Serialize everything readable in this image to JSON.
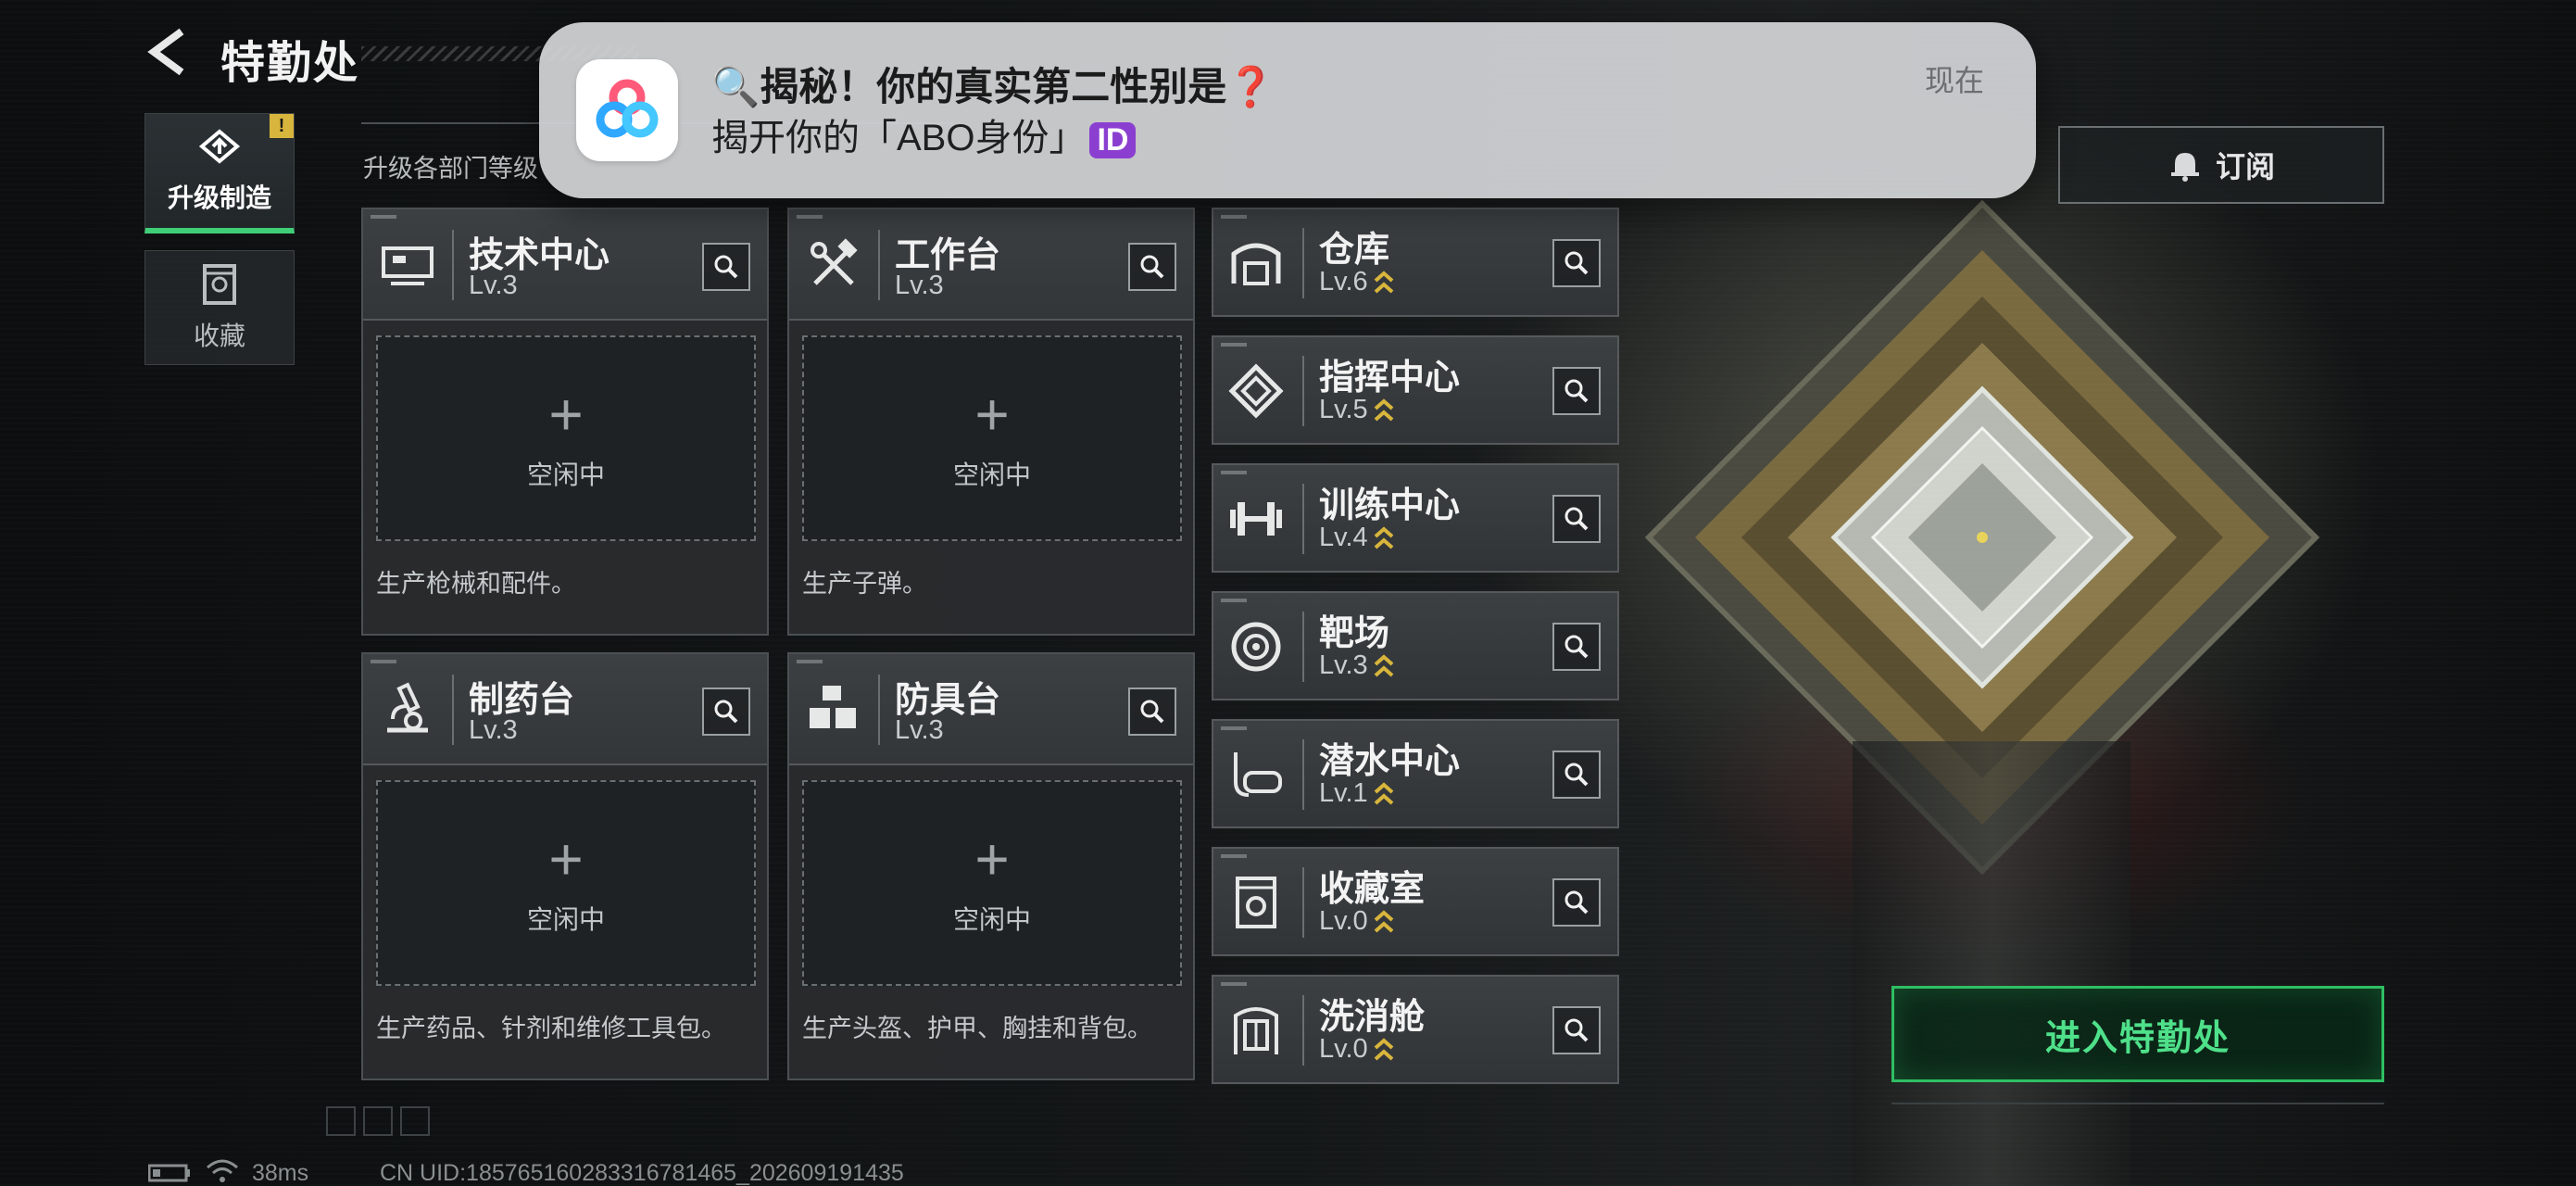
{
  "header": {
    "title": "特勤处"
  },
  "nav": {
    "items": [
      {
        "label": "升级制造",
        "badge": "!"
      },
      {
        "label": "收藏"
      }
    ]
  },
  "subtitle": "升级各部门等级",
  "stations": [
    {
      "name": "技术中心",
      "level": "Lv.3",
      "slot": "空闲中",
      "desc": "生产枪械和配件。"
    },
    {
      "name": "工作台",
      "level": "Lv.3",
      "slot": "空闲中",
      "desc": "生产子弹。"
    },
    {
      "name": "制药台",
      "level": "Lv.3",
      "slot": "空闲中",
      "desc": "生产药品、针剂和维修工具包。"
    },
    {
      "name": "防具台",
      "level": "Lv.3",
      "slot": "空闲中",
      "desc": "生产头盔、护甲、胸挂和背包。"
    }
  ],
  "facilities": [
    {
      "name": "仓库",
      "level": "Lv.6"
    },
    {
      "name": "指挥中心",
      "level": "Lv.5"
    },
    {
      "name": "训练中心",
      "level": "Lv.4"
    },
    {
      "name": "靶场",
      "level": "Lv.3"
    },
    {
      "name": "潜水中心",
      "level": "Lv.1"
    },
    {
      "name": "收藏室",
      "level": "Lv.0"
    },
    {
      "name": "洗消舱",
      "level": "Lv.0"
    }
  ],
  "actions": {
    "subscribe": "订阅",
    "enter": "进入特勤处"
  },
  "status": {
    "ping": "38ms",
    "uid": "CN UID:18576516028331678146​5_202609191435"
  },
  "notification": {
    "title": "🔍揭秘！你的真实第二性别是❓",
    "body": "揭开你的「ABO身份」",
    "badge": "ID",
    "time": "现在"
  },
  "colors": {
    "accent_green": "#3fcf78",
    "enter_text": "#4fe08a",
    "upgrade_chevron": "#d8b53c",
    "notif_badge": "#8b3fd0"
  }
}
